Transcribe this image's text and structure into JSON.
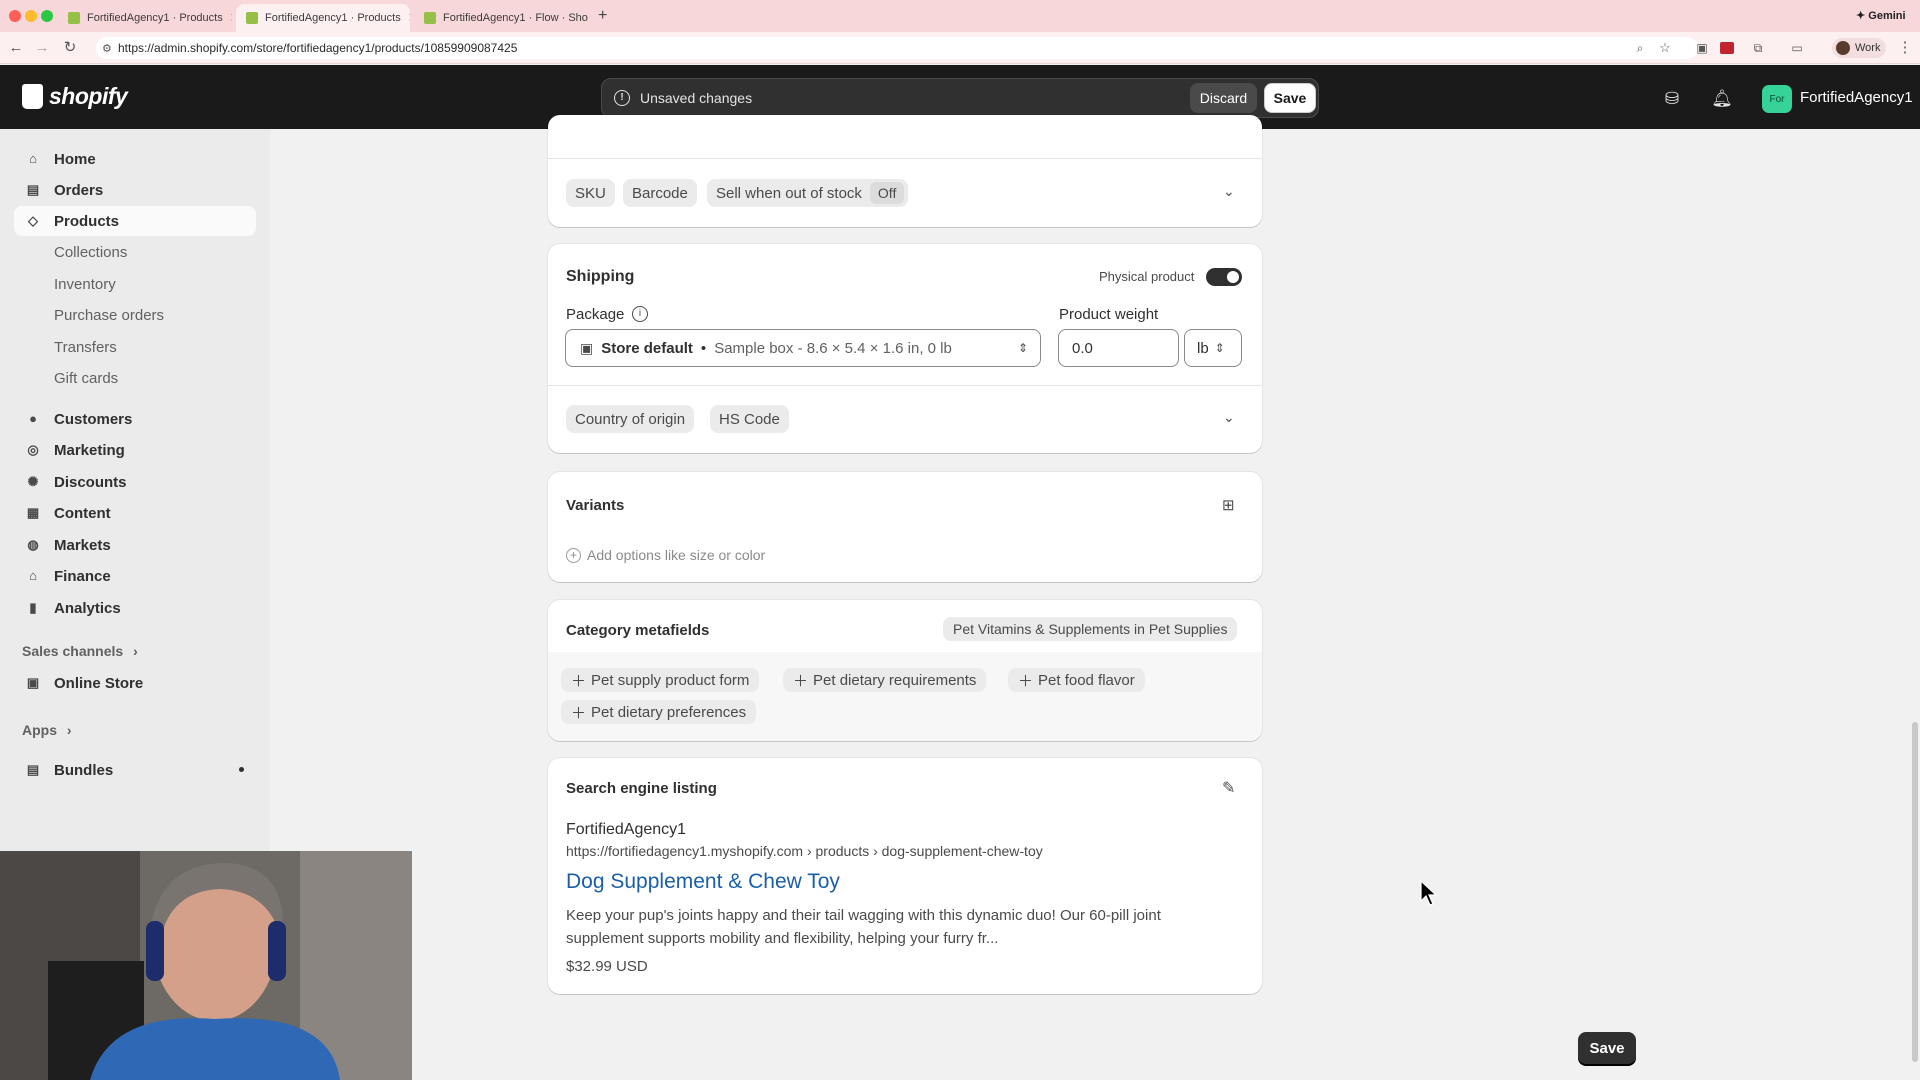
{
  "browser": {
    "tabs": [
      {
        "title": "FortifiedAgency1 · Products"
      },
      {
        "title": "FortifiedAgency1 · Products"
      },
      {
        "title": "FortifiedAgency1 · Flow · Sho"
      }
    ],
    "gemini_label": "Gemini",
    "url": "https://admin.shopify.com/store/fortifiedagency1/products/10859909087425",
    "profile_label": "Work"
  },
  "topbar": {
    "logo_text": "shopify",
    "unsaved_text": "Unsaved changes",
    "discard_label": "Discard",
    "save_label": "Save",
    "store_avatar": "For",
    "store_name": "FortifiedAgency1"
  },
  "sidebar": {
    "items": [
      {
        "label": "Home",
        "icon": "home-icon"
      },
      {
        "label": "Orders",
        "icon": "orders-icon"
      },
      {
        "label": "Products",
        "icon": "tag-icon",
        "selected": true
      },
      {
        "label": "Customers",
        "icon": "person-icon"
      },
      {
        "label": "Marketing",
        "icon": "target-icon"
      },
      {
        "label": "Discounts",
        "icon": "discount-icon"
      },
      {
        "label": "Content",
        "icon": "content-icon"
      },
      {
        "label": "Markets",
        "icon": "globe-icon"
      },
      {
        "label": "Finance",
        "icon": "bank-icon"
      },
      {
        "label": "Analytics",
        "icon": "chart-icon"
      }
    ],
    "product_subitems": [
      "Collections",
      "Inventory",
      "Purchase orders",
      "Transfers",
      "Gift cards"
    ],
    "sales_channels_label": "Sales channels",
    "online_store_label": "Online Store",
    "apps_label": "Apps",
    "bundles_label": "Bundles"
  },
  "inventory_card": {
    "sku_label": "SKU",
    "barcode_label": "Barcode",
    "sell_oos_label": "Sell when out of stock",
    "sell_oos_value": "Off"
  },
  "shipping": {
    "title": "Shipping",
    "physical_label": "Physical product",
    "physical_on": true,
    "package_label": "Package",
    "package_name": "Store default",
    "package_detail": "Sample box - 8.6 × 5.4 × 1.6 in, 0 lb",
    "weight_label": "Product weight",
    "weight_value": "0.0",
    "weight_unit": "lb",
    "country_label": "Country of origin",
    "hs_label": "HS Code"
  },
  "variants": {
    "title": "Variants",
    "add_options": "Add options like size or color"
  },
  "category_metafields": {
    "title": "Category metafields",
    "category": "Pet Vitamins & Supplements in Pet Supplies",
    "fields": [
      "Pet supply product form",
      "Pet dietary requirements",
      "Pet food flavor",
      "Pet dietary preferences"
    ]
  },
  "seo": {
    "title": "Search engine listing",
    "store": "FortifiedAgency1",
    "url": "https://fortifiedagency1.myshopify.com › products › dog-supplement-chew-toy",
    "page_title": "Dog Supplement & Chew Toy",
    "description": "Keep your pup's joints happy and their tail wagging with this dynamic duo! Our 60-pill joint supplement supports mobility and flexibility, helping your furry fr...",
    "price": "$32.99 USD"
  },
  "bottom_save_label": "Save"
}
